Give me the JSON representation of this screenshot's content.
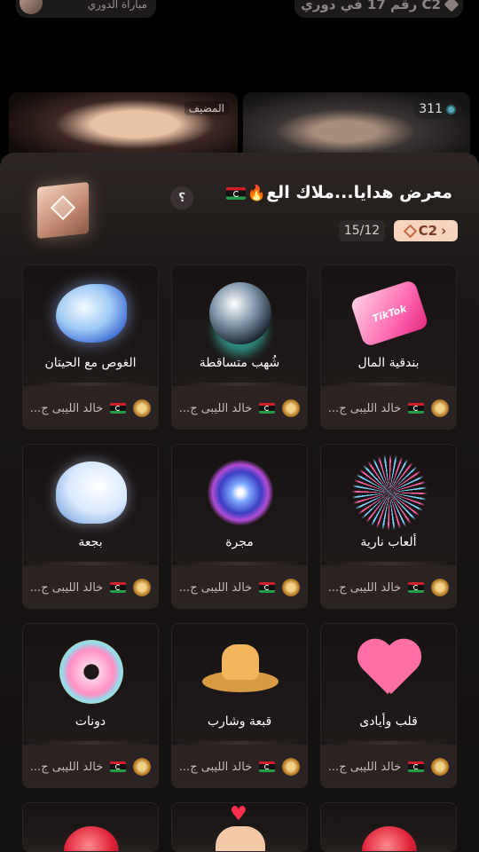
{
  "background": {
    "left_pill_text": "مباراة الدوري",
    "right_pill_text": "رقم 17 في دوري C2",
    "host_tag": "المضيف",
    "viewer_count": "311"
  },
  "sheet": {
    "title": "معرض هدايا...ملاك الع",
    "help_label": "؟",
    "level_label": "C2",
    "count_label": "15/12"
  },
  "gifts": [
    {
      "name": "بندقية المال",
      "sender": "خالد الليبى ج...",
      "icon": "money-gun-icon"
    },
    {
      "name": "شُهب متساقطة",
      "sender": "خالد الليبى ج...",
      "icon": "meteor-shower-icon"
    },
    {
      "name": "الغوص مع الحيتان",
      "sender": "خالد الليبى ج...",
      "icon": "whale-diving-icon"
    },
    {
      "name": "ألعاب نارية",
      "sender": "خالد الليبى ج...",
      "icon": "fireworks-icon"
    },
    {
      "name": "مجرة",
      "sender": "خالد الليبى ج...",
      "icon": "galaxy-icon"
    },
    {
      "name": "بجعة",
      "sender": "خالد الليبى ج...",
      "icon": "swan-icon"
    },
    {
      "name": "قلب وأيادى",
      "sender": "خالد الليبى ج...",
      "icon": "heart-hands-icon"
    },
    {
      "name": "قبعة وشارب",
      "sender": "خالد الليبى ج...",
      "icon": "hat-mustache-icon"
    },
    {
      "name": "دونات",
      "sender": "خالد الليبى ج...",
      "icon": "donut-icon"
    }
  ],
  "colors": {
    "sheet_top": "#2c2523",
    "level_tag_bg": "#f8d3bd",
    "level_tag_text": "#7c3b23"
  }
}
